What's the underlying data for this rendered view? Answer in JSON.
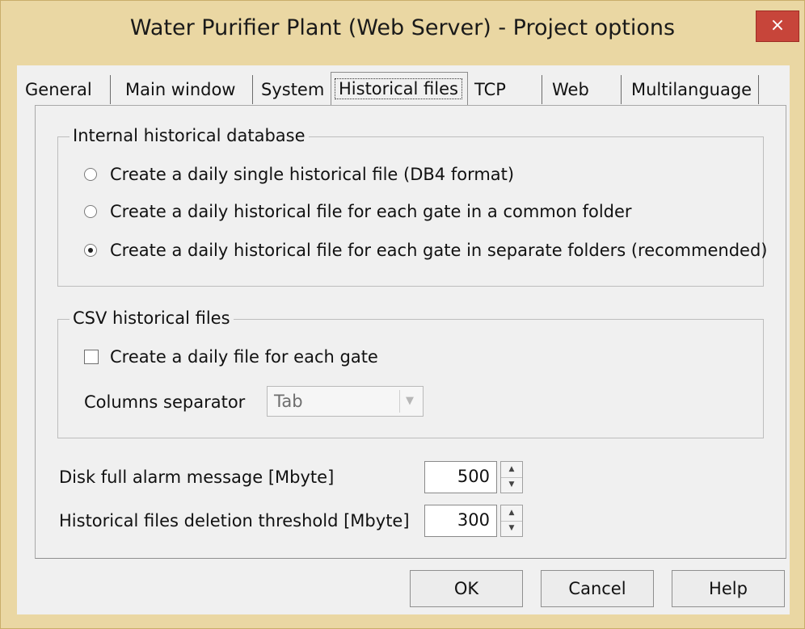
{
  "window": {
    "title": "Water Purifier Plant (Web Server) - Project options",
    "close_glyph": "×"
  },
  "tabs": [
    {
      "label": "General"
    },
    {
      "label": "Main window"
    },
    {
      "label": "System"
    },
    {
      "label": "Historical files",
      "active": true
    },
    {
      "label": "TCP"
    },
    {
      "label": "Web"
    },
    {
      "label": "Multilanguage"
    }
  ],
  "internal_db": {
    "title": "Internal historical database",
    "options": [
      {
        "label": "Create a daily single historical file (DB4 format)",
        "selected": false
      },
      {
        "label": "Create a daily historical file for each gate in a common folder",
        "selected": false
      },
      {
        "label": "Create a daily historical file for each gate in separate folders (recommended)",
        "selected": true
      }
    ]
  },
  "csv": {
    "title": "CSV historical files",
    "checkbox_label": "Create a daily file for each gate",
    "checked": false,
    "separator_label": "Columns separator",
    "separator_value": "Tab"
  },
  "disk_full": {
    "label": "Disk full alarm message [Mbyte]",
    "value": "500"
  },
  "deletion": {
    "label": "Historical files deletion threshold [Mbyte]",
    "value": "300"
  },
  "buttons": {
    "ok": "OK",
    "cancel": "Cancel",
    "help": "Help"
  }
}
